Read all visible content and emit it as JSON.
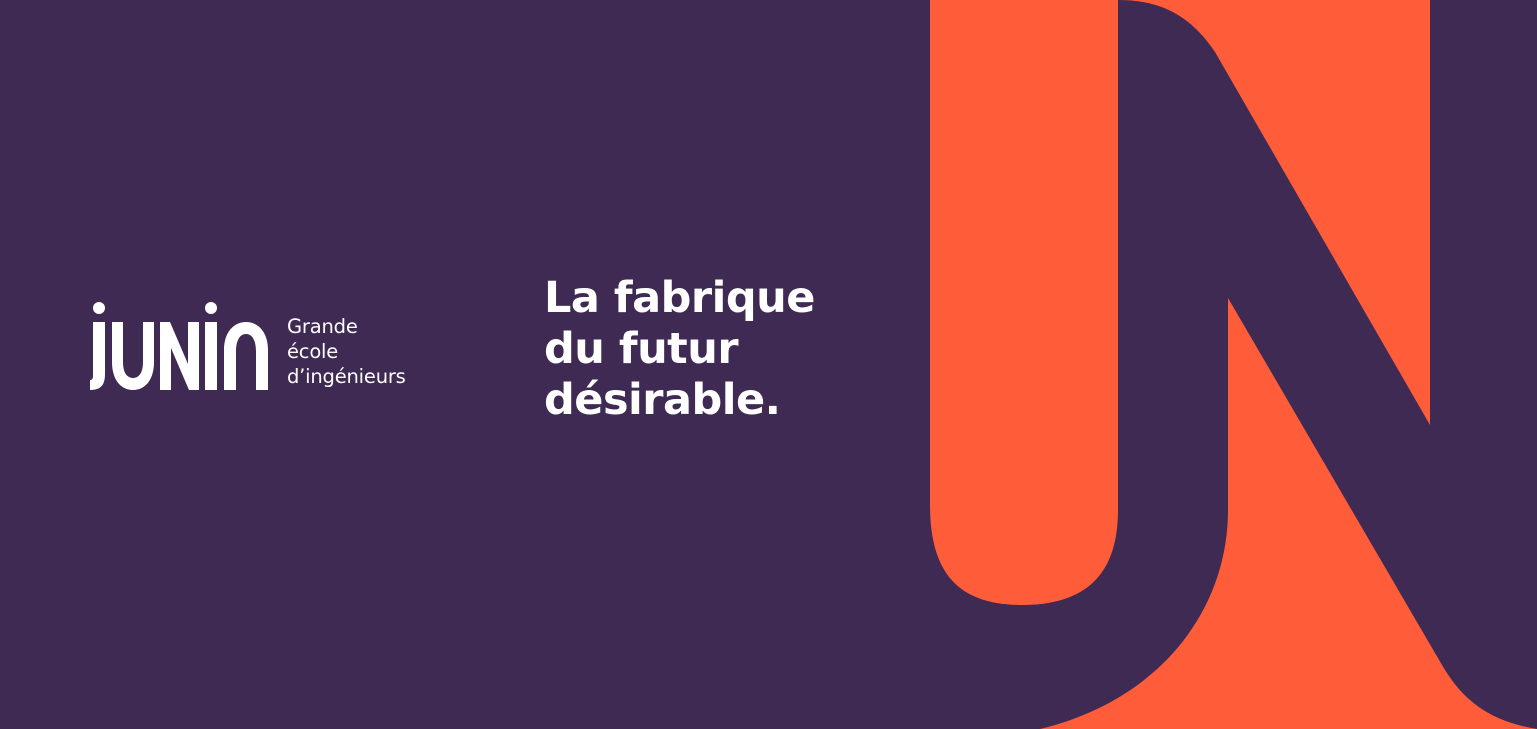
{
  "brand": {
    "logo_text": "JUNIA",
    "subtitle_lines": [
      "Grande",
      "école",
      "d’ingénieurs"
    ]
  },
  "tagline": {
    "lines": [
      "La fabrique",
      "du futur",
      "désirable."
    ]
  },
  "colors": {
    "background": "#3e2a53",
    "accent": "#ff5c3a",
    "text": "#ffffff"
  }
}
